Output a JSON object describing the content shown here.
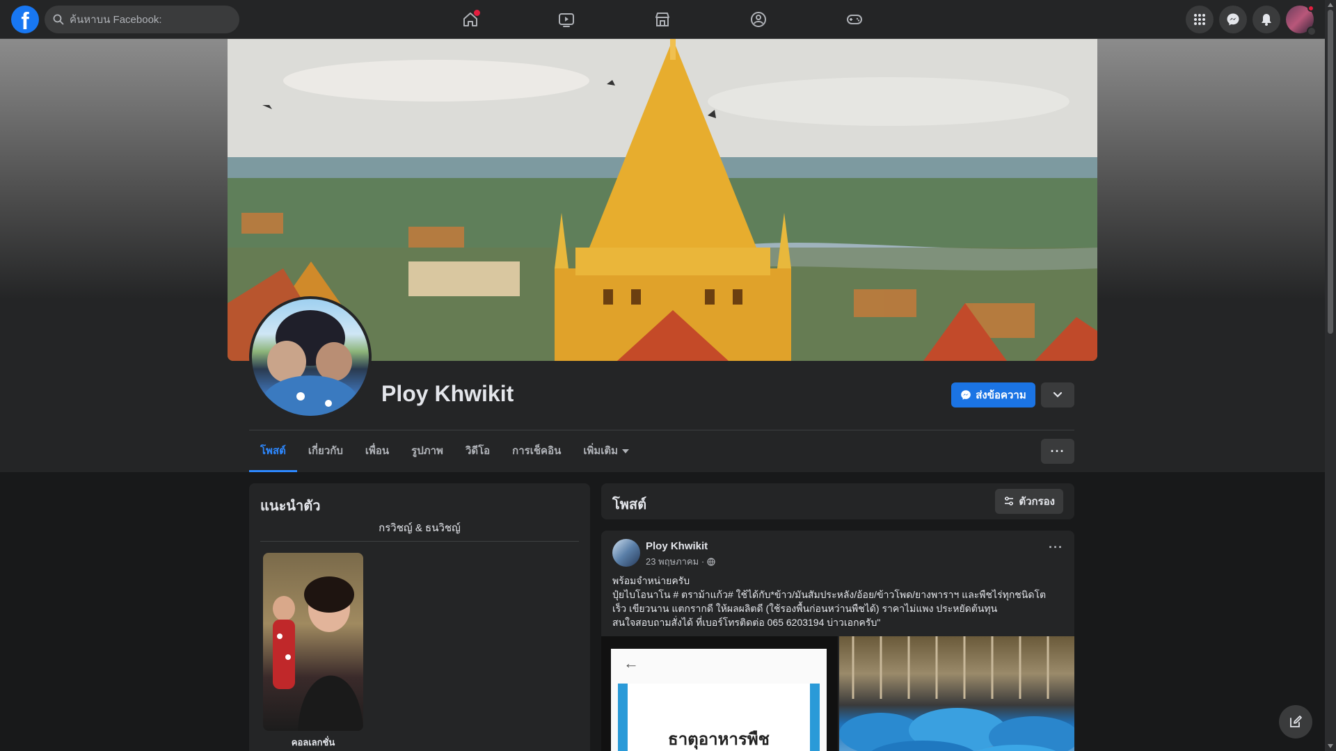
{
  "topbar": {
    "logo_letter": "f",
    "search_placeholder": "ค้นหาบน Facebook:",
    "nav": [
      "home-icon",
      "watch-icon",
      "marketplace-icon",
      "groups-icon",
      "gaming-icon"
    ],
    "right": [
      "menu-grid-icon",
      "messenger-icon",
      "notifications-icon",
      "account-avatar"
    ]
  },
  "profile": {
    "name": "Ploy Khwikit",
    "message_button": "ส่งข้อความ"
  },
  "tabs": [
    {
      "label": "โพสต์",
      "active": true
    },
    {
      "label": "เกี่ยวกับ"
    },
    {
      "label": "เพื่อน"
    },
    {
      "label": "รูปภาพ"
    },
    {
      "label": "วิดีโอ"
    },
    {
      "label": "การเช็คอิน"
    },
    {
      "label": "เพิ่มเติม"
    }
  ],
  "more_button": "···",
  "intro": {
    "title": "แนะนำตัว",
    "bio": "กรวิชญ์ & ธนวิชญ์",
    "featured_label": "คอลเลกชั่น"
  },
  "posts": {
    "title": "โพสต์",
    "filter_label": "ตัวกรอง",
    "items": [
      {
        "author": "Ploy Khwikit",
        "date": "23 พฤษภาคม ·",
        "lines": [
          "พร้อมจำหน่ายครับ",
          "ปุ๋ยไบโอนาโน # ตราม้าแก้ว# ใช้ได้กับ*ข้าว/มันสัมประหลัง/อ้อย/ข้าวโพด/ยางพาราฯ และพืชไร่ทุกชนิดโต",
          "เร็ว เขียวนาน แตกรากดี ให้ผลผลิตดี (ใช้รองพื้นก่อนหว่านพืชได้) ราคาไม่แพง ประหยัดต้นทุน",
          "สนใจสอบถามสั่งได้ ที่เบอร์โทรติดต่อ 065 6203194 บ่าวเอกครับ\""
        ],
        "image1_text": "ธาตุอาหารพืช"
      }
    ]
  },
  "colors": {
    "accent": "#2d88ff",
    "button_blue": "#1b74e4",
    "surface": "#242526",
    "background": "#18191a",
    "notification_red": "#e41e3f"
  }
}
